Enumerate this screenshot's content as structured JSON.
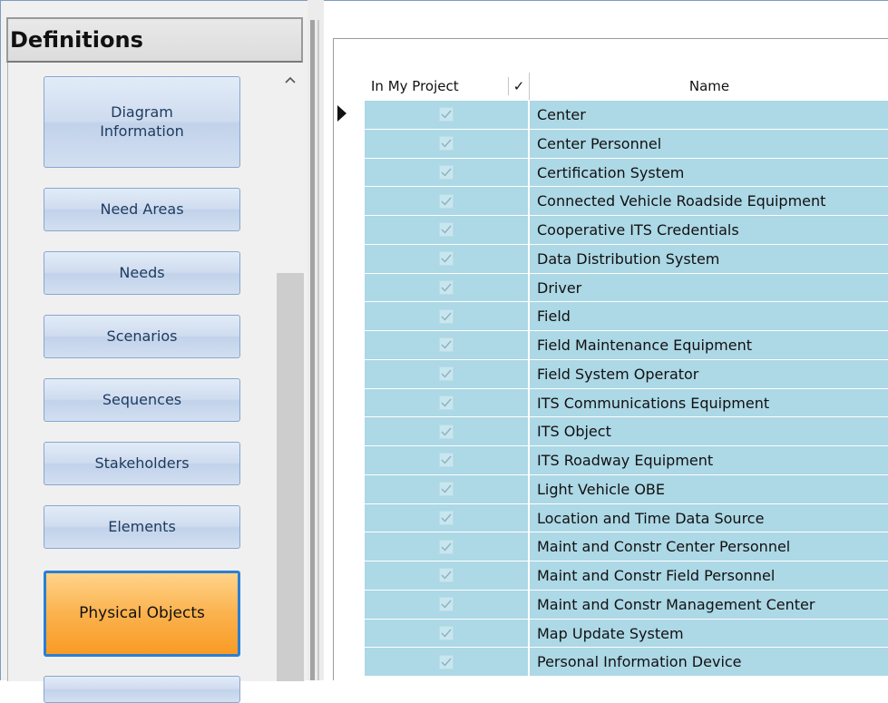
{
  "panel": {
    "title": "Definitions",
    "buttons": [
      {
        "line1": "Diagram",
        "line2": "Information"
      },
      {
        "line1": "Need Areas"
      },
      {
        "line1": "Needs"
      },
      {
        "line1": "Scenarios"
      },
      {
        "line1": "Sequences"
      },
      {
        "line1": "Stakeholders"
      },
      {
        "line1": "Elements"
      },
      {
        "line1": "Physical Objects"
      }
    ],
    "active_button": "Physical Objects",
    "scroll_up_icon": "chevron-up-icon"
  },
  "grid": {
    "header": {
      "in_my_project": "In My Project",
      "check": "✓",
      "name": "Name"
    },
    "rows": [
      {
        "checked": true,
        "name": "Center"
      },
      {
        "checked": true,
        "name": "Center Personnel"
      },
      {
        "checked": true,
        "name": "Certification System"
      },
      {
        "checked": true,
        "name": "Connected Vehicle Roadside Equipment"
      },
      {
        "checked": true,
        "name": "Cooperative ITS Credentials"
      },
      {
        "checked": true,
        "name": "Data Distribution System"
      },
      {
        "checked": true,
        "name": "Driver"
      },
      {
        "checked": true,
        "name": "Field"
      },
      {
        "checked": true,
        "name": "Field Maintenance Equipment"
      },
      {
        "checked": true,
        "name": "Field System Operator"
      },
      {
        "checked": true,
        "name": "ITS Communications Equipment"
      },
      {
        "checked": true,
        "name": "ITS Object"
      },
      {
        "checked": true,
        "name": "ITS Roadway Equipment"
      },
      {
        "checked": true,
        "name": "Light Vehicle OBE"
      },
      {
        "checked": true,
        "name": "Location and Time Data Source"
      },
      {
        "checked": true,
        "name": "Maint and Constr Center Personnel"
      },
      {
        "checked": true,
        "name": "Maint and Constr Field Personnel"
      },
      {
        "checked": true,
        "name": "Maint and Constr Management Center"
      },
      {
        "checked": true,
        "name": "Map Update System"
      },
      {
        "checked": true,
        "name": "Personal Information Device"
      }
    ],
    "row_color": "#add8e6"
  }
}
